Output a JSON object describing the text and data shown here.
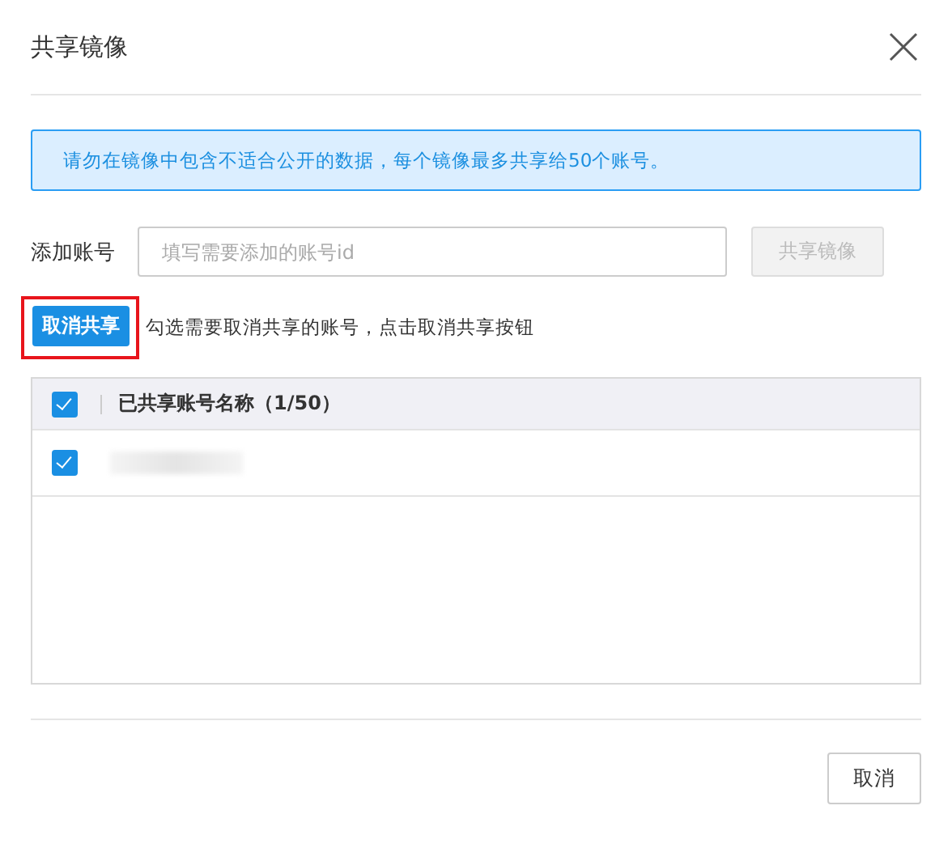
{
  "dialog": {
    "title": "共享镜像"
  },
  "notice": "请勿在镜像中包含不适合公开的数据，每个镜像最多共享给50个账号。",
  "add_account": {
    "label": "添加账号",
    "placeholder": "填写需要添加的账号id",
    "button": {
      "label": "共享镜像",
      "disabled": true
    }
  },
  "unshare": {
    "button": {
      "label": "取消共享",
      "highlighted": true
    },
    "hint": "勾选需要取消共享的账号，点击取消共享按钮"
  },
  "table": {
    "header": {
      "checked": true,
      "label": "已共享账号名称（1/50）"
    },
    "rows": [
      {
        "checked": true,
        "redacted": true
      }
    ]
  },
  "footer": {
    "buttons": [
      "取消"
    ]
  }
}
